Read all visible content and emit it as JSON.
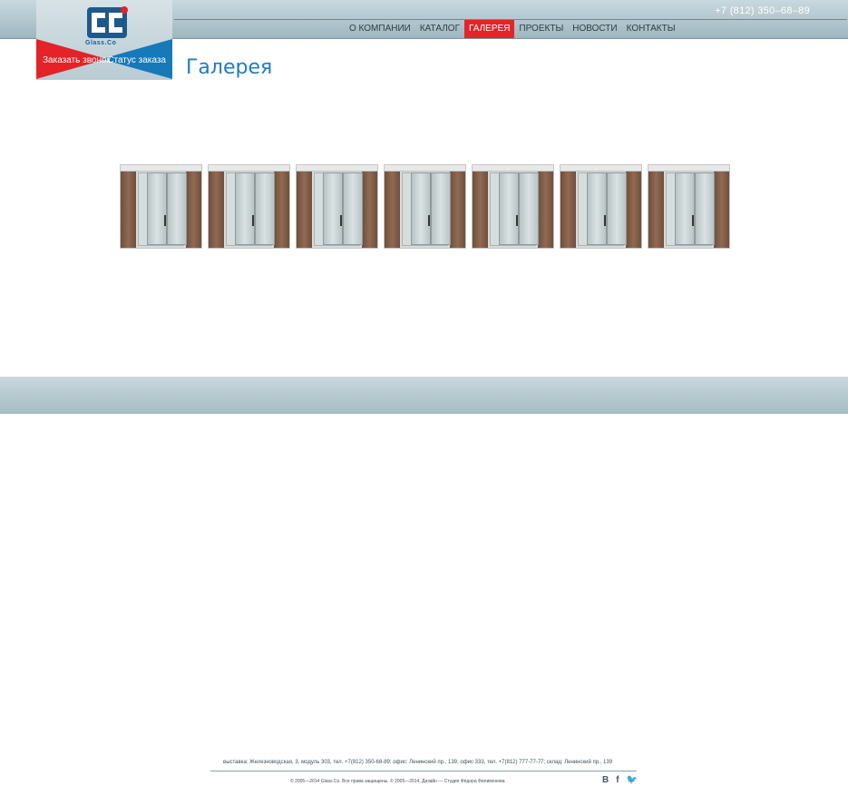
{
  "header": {
    "phone": "+7 (812) 350–68–89"
  },
  "nav": {
    "items": [
      {
        "label": "О КОМПАНИИ",
        "active": false
      },
      {
        "label": "КАТАЛОГ",
        "active": false
      },
      {
        "label": "ГАЛЕРЕЯ",
        "active": true
      },
      {
        "label": "ПРОЕКТЫ",
        "active": false
      },
      {
        "label": "НОВОСТИ",
        "active": false
      },
      {
        "label": "КОНТАКТЫ",
        "active": false
      }
    ]
  },
  "logo": {
    "text": "Glass.Co",
    "left_action": "Заказать звонок",
    "right_action": "Статус заказа",
    "accent_red": "#e42227",
    "accent_blue": "#1679b9"
  },
  "page": {
    "title": "Галерея"
  },
  "gallery": {
    "items": [
      {
        "icon": "glass-door-image"
      },
      {
        "icon": "glass-door-image"
      },
      {
        "icon": "glass-door-image"
      },
      {
        "icon": "glass-door-image"
      },
      {
        "icon": "glass-door-image"
      },
      {
        "icon": "glass-door-image"
      },
      {
        "icon": "glass-door-image"
      }
    ]
  },
  "footer": {
    "address": "выставка: Железноводская, 3, модуль 303, тел. +7(812) 350-68-89; офис: Ленинский пр., 139, офис 333, тел. +7(812) 777-77-77; склад: Ленинский пр., 139",
    "copyright": "© 2005—2014 Glass.Co. Все права защищены. © 2005—2014, Дизайн — Студия Фёдора Филимонова",
    "social": [
      "В",
      "f",
      "🐦"
    ]
  }
}
